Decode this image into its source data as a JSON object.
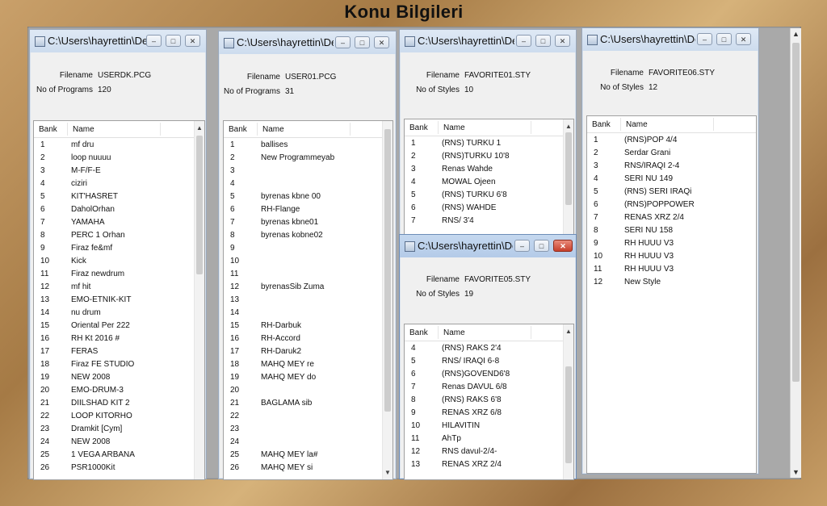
{
  "frame_title": "Konu Bilgileri",
  "windows": [
    {
      "title": "C:\\Users\\hayrettin\\Deskt...",
      "filename_label": "Filename",
      "filename": "USERDK.PCG",
      "count_label": "No of Programs",
      "count": "120",
      "col_bank": "Bank",
      "col_name": "Name",
      "rows": [
        [
          "1",
          "mf dru"
        ],
        [
          "2",
          "loop nuuuu"
        ],
        [
          "3",
          "M-F/F-E"
        ],
        [
          "4",
          "ciziri"
        ],
        [
          "5",
          "KIT'HASRET"
        ],
        [
          "6",
          "DaholOrhan"
        ],
        [
          "7",
          "YAMAHA"
        ],
        [
          "8",
          "PERC 1 Orhan"
        ],
        [
          "9",
          "Firaz fe&mf"
        ],
        [
          "10",
          "Kick"
        ],
        [
          "11",
          "Firaz newdrum"
        ],
        [
          "12",
          "mf hit"
        ],
        [
          "13",
          "EMO-ETNIK-KIT"
        ],
        [
          "14",
          "nu drum"
        ],
        [
          "15",
          "Oriental Per 222"
        ],
        [
          "16",
          "RH Kt 2016 #"
        ],
        [
          "17",
          "FERAS"
        ],
        [
          "18",
          "Firaz FE STUDIO"
        ],
        [
          "19",
          "NEW 2008"
        ],
        [
          "20",
          "EMO-DRUM-3"
        ],
        [
          "21",
          "DIILSHAD KIT 2"
        ],
        [
          "22",
          "LOOP KITORHO"
        ],
        [
          "23",
          "Dramkit [Cym]"
        ],
        [
          "24",
          "NEW 2008"
        ],
        [
          "25",
          "1 VEGA ARBANA"
        ],
        [
          "26",
          "PSR1000Kit"
        ]
      ]
    },
    {
      "title": "C:\\Users\\hayrettin\\Deskt...",
      "filename_label": "Filename",
      "filename": "USER01.PCG",
      "count_label": "No of Programs",
      "count": "31",
      "col_bank": "Bank",
      "col_name": "Name",
      "rows": [
        [
          "1",
          "ballises"
        ],
        [
          "2",
          "New Programmeyab"
        ],
        [
          "3",
          ""
        ],
        [
          "4",
          ""
        ],
        [
          "5",
          "byrenas kbne 00"
        ],
        [
          "6",
          "RH-Flange"
        ],
        [
          "7",
          "byrenas kbne01"
        ],
        [
          "8",
          "byrenas kobne02"
        ],
        [
          "9",
          ""
        ],
        [
          "10",
          ""
        ],
        [
          "11",
          ""
        ],
        [
          "12",
          "byrenasSib Zuma"
        ],
        [
          "13",
          ""
        ],
        [
          "14",
          ""
        ],
        [
          "15",
          "RH-Darbuk"
        ],
        [
          "16",
          "RH-Accord"
        ],
        [
          "17",
          "RH-Daruk2"
        ],
        [
          "18",
          "MAHQ MEY re"
        ],
        [
          "19",
          "MAHQ MEY do"
        ],
        [
          "20",
          ""
        ],
        [
          "21",
          "BAGLAMA sib"
        ],
        [
          "22",
          ""
        ],
        [
          "23",
          ""
        ],
        [
          "24",
          ""
        ],
        [
          "25",
          "MAHQ MEY la#"
        ],
        [
          "26",
          "MAHQ MEY si"
        ]
      ]
    },
    {
      "title": "C:\\Users\\hayrettin\\Deskt...",
      "filename_label": "Filename",
      "filename": "FAVORITE01.STY",
      "count_label": "No of Styles",
      "count": "10",
      "col_bank": "Bank",
      "col_name": "Name",
      "rows": [
        [
          "1",
          "(RNS) TURKU 1"
        ],
        [
          "2",
          "(RNS)TURKU 10'8"
        ],
        [
          "3",
          "Renas Wahde"
        ],
        [
          "4",
          "MOWAL Ojeen"
        ],
        [
          "5",
          "(RNS) TURKU 6'8"
        ],
        [
          "6",
          "(RNS) WAHDE"
        ],
        [
          "7",
          "RNS/ 3'4"
        ]
      ]
    },
    {
      "title": "C:\\Users\\hayrettin\\Deskt...",
      "filename_label": "Filename",
      "filename": "FAVORITE06.STY",
      "count_label": "No of Styles",
      "count": "12",
      "col_bank": "Bank",
      "col_name": "Name",
      "rows": [
        [
          "1",
          "(RNS)POP 4/4"
        ],
        [
          "2",
          "Serdar Grani"
        ],
        [
          "3",
          "RNS/IRAQI 2-4"
        ],
        [
          "4",
          "SERI NU 149"
        ],
        [
          "5",
          "(RNS) SERI IRAQi"
        ],
        [
          "6",
          "(RNS)POPPOWER"
        ],
        [
          "7",
          "RENAS XRZ 2/4"
        ],
        [
          "8",
          "SERI NU 158"
        ],
        [
          "9",
          "RH HUUU V3"
        ],
        [
          "10",
          "RH HUUU V3"
        ],
        [
          "11",
          "RH HUUU V3"
        ],
        [
          "12",
          "New Style"
        ]
      ]
    },
    {
      "title": "C:\\Users\\hayrettin\\Deskt...",
      "filename_label": "Filename",
      "filename": "FAVORITE05.STY",
      "count_label": "No of Styles",
      "count": "19",
      "col_bank": "Bank",
      "col_name": "Name",
      "rows": [
        [
          "4",
          "(RNS) RAKS 2'4"
        ],
        [
          "5",
          "RNS/ IRAQI 6-8"
        ],
        [
          "6",
          "(RNS)GOVEND6'8"
        ],
        [
          "7",
          "Renas DAVUL 6/8"
        ],
        [
          "8",
          "(RNS) RAKS 6'8"
        ],
        [
          "9",
          "RENAS XRZ 6/8"
        ],
        [
          "10",
          "HILAVITIN"
        ],
        [
          "11",
          "AhTp"
        ],
        [
          "12",
          "RNS davul-2/4-"
        ],
        [
          "13",
          "RENAS XRZ 2/4"
        ]
      ]
    }
  ],
  "title_buttons": {
    "minimize": "–",
    "maximize": "□",
    "close": "✕"
  },
  "icons": [
    "app-icon",
    "minimize-icon",
    "maximize-icon",
    "close-icon",
    "scroll-up-icon",
    "scroll-down-icon"
  ]
}
